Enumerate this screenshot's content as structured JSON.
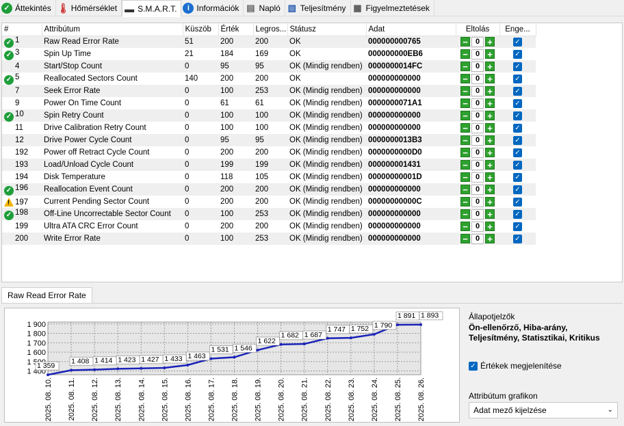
{
  "tabs": [
    {
      "label": "Áttekintés",
      "icon": "check-icon"
    },
    {
      "label": "Hőmérséklet",
      "icon": "thermometer-icon"
    },
    {
      "label": "S.M.A.R.T.",
      "icon": "smart-icon"
    },
    {
      "label": "Információk",
      "icon": "info-icon"
    },
    {
      "label": "Napló",
      "icon": "log-icon"
    },
    {
      "label": "Teljesítmény",
      "icon": "performance-icon"
    },
    {
      "label": "Figyelmeztetések",
      "icon": "alerts-icon"
    }
  ],
  "table": {
    "headers": [
      "#",
      "Attribútum",
      "Küszöb",
      "Érték",
      "Legros...",
      "Státusz",
      "Adat",
      "Eltolás",
      "Enge..."
    ],
    "rows": [
      {
        "status": "ok",
        "id": "1",
        "name": "Raw Read Error Rate",
        "threshold": "51",
        "value": "200",
        "worst": "200",
        "state": "OK",
        "data": "000000000765",
        "offset": "0"
      },
      {
        "status": "ok",
        "id": "3",
        "name": "Spin Up Time",
        "threshold": "21",
        "value": "184",
        "worst": "169",
        "state": "OK",
        "data": "000000000EB6",
        "offset": "0"
      },
      {
        "status": "none",
        "id": "4",
        "name": "Start/Stop Count",
        "threshold": "0",
        "value": "95",
        "worst": "95",
        "state": "OK (Mindig rendben)",
        "data": "0000000014FC",
        "offset": "0"
      },
      {
        "status": "ok",
        "id": "5",
        "name": "Reallocated Sectors Count",
        "threshold": "140",
        "value": "200",
        "worst": "200",
        "state": "OK",
        "data": "000000000000",
        "offset": "0"
      },
      {
        "status": "none",
        "id": "7",
        "name": "Seek Error Rate",
        "threshold": "0",
        "value": "100",
        "worst": "253",
        "state": "OK (Mindig rendben)",
        "data": "000000000000",
        "offset": "0"
      },
      {
        "status": "none",
        "id": "9",
        "name": "Power On Time Count",
        "threshold": "0",
        "value": "61",
        "worst": "61",
        "state": "OK (Mindig rendben)",
        "data": "0000000071A1",
        "offset": "0"
      },
      {
        "status": "ok",
        "id": "10",
        "name": "Spin Retry Count",
        "threshold": "0",
        "value": "100",
        "worst": "100",
        "state": "OK (Mindig rendben)",
        "data": "000000000000",
        "offset": "0"
      },
      {
        "status": "none",
        "id": "11",
        "name": "Drive Calibration Retry Count",
        "threshold": "0",
        "value": "100",
        "worst": "100",
        "state": "OK (Mindig rendben)",
        "data": "000000000000",
        "offset": "0"
      },
      {
        "status": "none",
        "id": "12",
        "name": "Drive Power Cycle Count",
        "threshold": "0",
        "value": "95",
        "worst": "95",
        "state": "OK (Mindig rendben)",
        "data": "0000000013B3",
        "offset": "0"
      },
      {
        "status": "none",
        "id": "192",
        "name": "Power off Retract Cycle Count",
        "threshold": "0",
        "value": "200",
        "worst": "200",
        "state": "OK (Mindig rendben)",
        "data": "0000000000D0",
        "offset": "0"
      },
      {
        "status": "none",
        "id": "193",
        "name": "Load/Unload Cycle Count",
        "threshold": "0",
        "value": "199",
        "worst": "199",
        "state": "OK (Mindig rendben)",
        "data": "000000001431",
        "offset": "0"
      },
      {
        "status": "none",
        "id": "194",
        "name": "Disk Temperature",
        "threshold": "0",
        "value": "118",
        "worst": "105",
        "state": "OK (Mindig rendben)",
        "data": "00000000001D",
        "offset": "0"
      },
      {
        "status": "ok",
        "id": "196",
        "name": "Reallocation Event Count",
        "threshold": "0",
        "value": "200",
        "worst": "200",
        "state": "OK (Mindig rendben)",
        "data": "000000000000",
        "offset": "0"
      },
      {
        "status": "warn",
        "id": "197",
        "name": "Current Pending Sector Count",
        "threshold": "0",
        "value": "200",
        "worst": "200",
        "state": "OK (Mindig rendben)",
        "data": "00000000000C",
        "offset": "0"
      },
      {
        "status": "ok",
        "id": "198",
        "name": "Off-Line Uncorrectable Sector Count",
        "threshold": "0",
        "value": "100",
        "worst": "253",
        "state": "OK (Mindig rendben)",
        "data": "000000000000",
        "offset": "0"
      },
      {
        "status": "none",
        "id": "199",
        "name": "Ultra ATA CRC Error Count",
        "threshold": "0",
        "value": "200",
        "worst": "200",
        "state": "OK (Mindig rendben)",
        "data": "000000000000",
        "offset": "0"
      },
      {
        "status": "none",
        "id": "200",
        "name": "Write Error Rate",
        "threshold": "0",
        "value": "100",
        "worst": "253",
        "state": "OK (Mindig rendben)",
        "data": "000000000000",
        "offset": "0"
      }
    ]
  },
  "bottom_tab": "Raw Read Error Rate",
  "panel": {
    "indicators_label": "Állapotjelzők",
    "indicators_value": "Ön-ellenőrző, Hiba-arány, Teljesítmény, Statisztikai, Kritikus",
    "show_values_label": "Értékek megjelenítése",
    "attr_chart_label": "Attribútum grafikon",
    "attr_chart_value": "Adat mező kijelzése"
  },
  "colors": {
    "ok": "#1e9e3a",
    "warn": "#f0b400",
    "line": "#1a22b8",
    "accent": "#0067c0"
  },
  "chart_data": {
    "type": "line",
    "x": [
      "2025. 08. 10.",
      "2025. 08. 11.",
      "2025. 08. 12.",
      "2025. 08. 13.",
      "2025. 08. 14.",
      "2025. 08. 15.",
      "2025. 08. 16.",
      "2025. 08. 17.",
      "2025. 08. 18.",
      "2025. 08. 19.",
      "2025. 08. 20.",
      "2025. 08. 21.",
      "2025. 08. 22.",
      "2025. 08. 23.",
      "2025. 08. 24.",
      "2025. 08. 25.",
      "2025. 08. 26."
    ],
    "values": [
      1359,
      1408,
      1414,
      1423,
      1427,
      1433,
      1463,
      1531,
      1546,
      1622,
      1682,
      1687,
      1747,
      1752,
      1790,
      1891,
      1893
    ],
    "labels": [
      "1 359",
      "1 408",
      "1 414",
      "1 423",
      "1 427",
      "1 433",
      "1 463",
      "1 531",
      "1 546",
      "1 622",
      "1 682",
      "1 687",
      "1 747",
      "1 752",
      "1 790",
      "1 891",
      "1 893"
    ],
    "yticks": [
      1400,
      1500,
      1600,
      1700,
      1800,
      1900
    ],
    "ytick_labels": [
      "1 400",
      "1 500",
      "1 600",
      "1 700",
      "1 800",
      "1 900"
    ],
    "ylim": [
      1360,
      1920
    ],
    "grid": true
  }
}
